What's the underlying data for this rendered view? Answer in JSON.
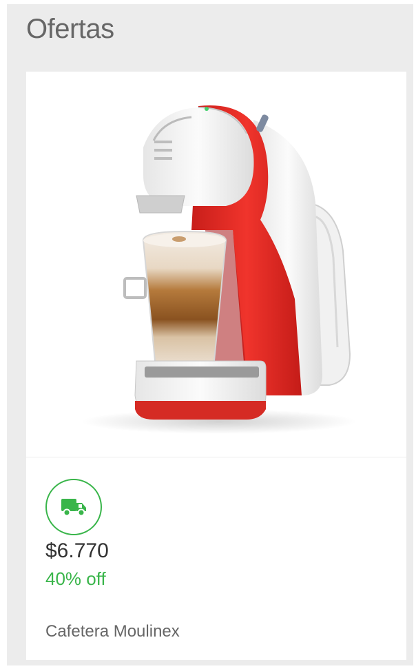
{
  "section": {
    "title": "Ofertas"
  },
  "product": {
    "image_icon": "coffee-machine-image",
    "shipping_icon": "truck-icon",
    "price": "$6.770",
    "discount": "40% off",
    "name": "Cafetera Moulinex"
  },
  "colors": {
    "panel_bg": "#ececec",
    "card_bg": "#ffffff",
    "discount_green": "#39b54a",
    "machine_red": "#e8302a"
  }
}
